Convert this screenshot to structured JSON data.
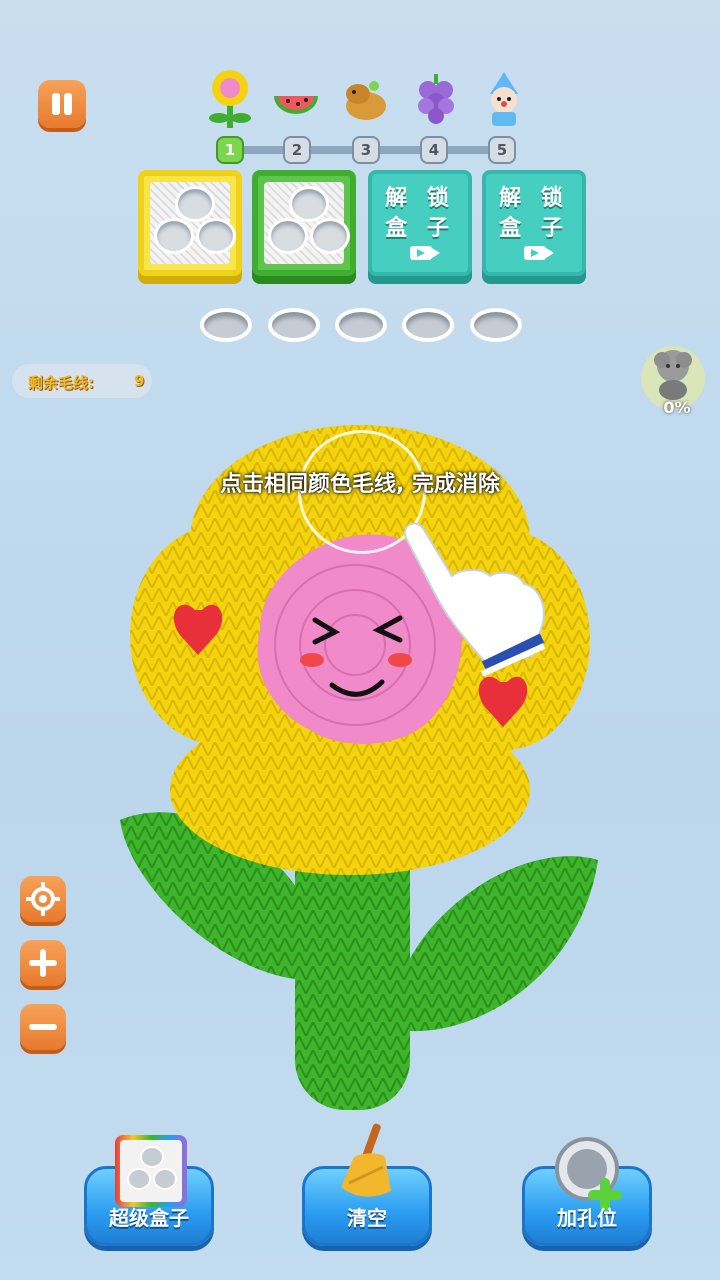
{
  "level_track": {
    "nodes": [
      "1",
      "2",
      "3",
      "4",
      "5"
    ],
    "active_index": 0,
    "level_icons": [
      "flower-icon",
      "watermelon-icon",
      "capybara-icon",
      "grape-icon",
      "clown-icon"
    ]
  },
  "boxes": {
    "unlock_label_line1": "解 锁",
    "unlock_label_line2": "盒 子"
  },
  "remaining": {
    "label": "剩余毛线:",
    "count": "9"
  },
  "progress": {
    "percent_text": "0%",
    "percent": 0
  },
  "instruction": "点击相同颜色毛线, 完成消除",
  "bottom_buttons": {
    "super_box": "超级盒子",
    "clear": "清空",
    "add_hole": "加孔位"
  },
  "colors": {
    "yarn_yellow": "#f5d40f",
    "yarn_pink": "#f08ac8",
    "yarn_green": "#3fb52b",
    "button_orange": "#ee8a3a",
    "button_blue": "#2b9cf0",
    "locked_teal": "#46cfc0"
  }
}
